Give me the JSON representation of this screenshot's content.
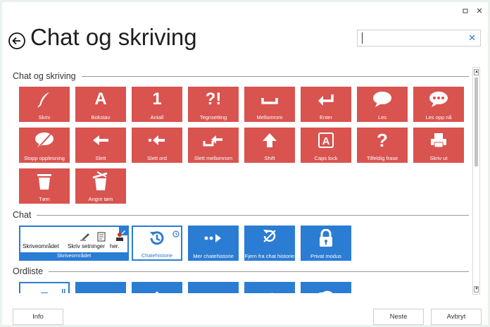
{
  "window": {
    "title": "Chat og skriving",
    "minimize_icon": "minimize-icon",
    "close_icon": "close-icon"
  },
  "search": {
    "value": "",
    "placeholder": "",
    "clear_icon": "clear-icon"
  },
  "colors": {
    "red_tile": "#d9534f",
    "blue_tile": "#2b7cd3",
    "selected_border": "#2b7cd3"
  },
  "sections": {
    "chat_og_skriving": {
      "title": "Chat og skriving",
      "tiles": [
        {
          "label": "Skriv",
          "icon": "quill-icon"
        },
        {
          "label": "Bokstav",
          "icon": "letter-a-icon"
        },
        {
          "label": "Antall",
          "icon": "number-one-icon"
        },
        {
          "label": "Tegnsetting",
          "icon": "punctuation-icon"
        },
        {
          "label": "Mellomrom",
          "icon": "space-icon"
        },
        {
          "label": "Enter",
          "icon": "enter-icon"
        },
        {
          "label": "Les",
          "icon": "speech-bubble-icon"
        },
        {
          "label": "Les opp nå",
          "icon": "speech-bubble-dots-icon"
        },
        {
          "label": "Stopp opplesning",
          "icon": "stop-speech-icon"
        },
        {
          "label": "Slett",
          "icon": "backspace-arrow-icon"
        },
        {
          "label": "Slett ord",
          "icon": "delete-word-icon"
        },
        {
          "label": "Slett mellomrom",
          "icon": "delete-space-icon"
        },
        {
          "label": "Shift",
          "icon": "shift-arrow-icon"
        },
        {
          "label": "Caps lock",
          "icon": "caps-lock-icon"
        },
        {
          "label": "Tilfeldig frase",
          "icon": "question-mark-icon"
        },
        {
          "label": "Skriv ut",
          "icon": "printer-icon"
        },
        {
          "label": "Tøm",
          "icon": "trash-icon"
        },
        {
          "label": "Angre tøm",
          "icon": "undo-trash-icon"
        }
      ]
    },
    "chat": {
      "title": "Chat",
      "wide_tile": {
        "label": "Skriveområdet",
        "preview_texts": [
          "Skriveområdet",
          "Skriv setninger",
          "her."
        ],
        "icon": "pencil-icon"
      },
      "tiles": [
        {
          "label": "Chatehistorie",
          "icon": "history-icon"
        },
        {
          "label": "Mer chatehistorie",
          "icon": "more-history-icon"
        },
        {
          "label": "Fjern fra chat historie",
          "icon": "remove-history-icon"
        },
        {
          "label": "Privat modus",
          "icon": "lock-icon"
        }
      ]
    },
    "ordliste": {
      "title": "Ordliste",
      "tiles": [
        {
          "icon": "list-icon"
        },
        {
          "icon": "more-icon"
        },
        {
          "icon": "plus-icon"
        },
        {
          "icon": "x-icon"
        },
        {
          "icon": "redo-icon"
        },
        {
          "icon": "undo-icon"
        }
      ]
    }
  },
  "footer": {
    "info": "Info",
    "next": "Neste",
    "cancel": "Avbryt"
  }
}
